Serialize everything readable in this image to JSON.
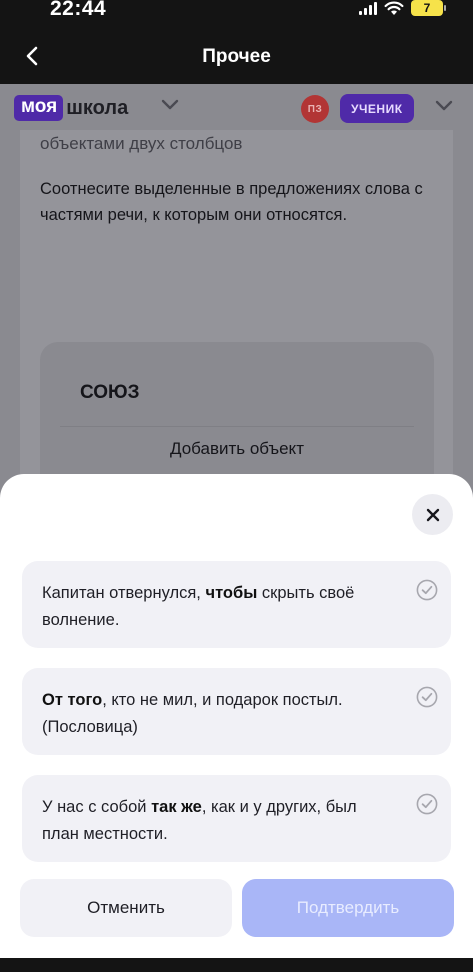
{
  "status": {
    "time": "22:44",
    "battery": "7"
  },
  "nav": {
    "title": "Прочее"
  },
  "header": {
    "logo_badge": "моя",
    "logo_text": "школа",
    "avatar_initials": "ПЗ",
    "role": "УЧЕНИК"
  },
  "task": {
    "cut_text": "объектами двух столбцов",
    "instruction": "Соотнесите выделенные в предложениях слова с частями речи, к которым они относятся.",
    "target_title": "СОЮЗ",
    "add_object_label": "Добавить объект"
  },
  "sheet": {
    "options": [
      {
        "before": "Капитан отвернулся, ",
        "bold": "чтобы",
        "after": " скрыть своё волнение."
      },
      {
        "before": "",
        "bold": "От того",
        "after": ", кто не мил, и подарок постыл. (Пословица)"
      },
      {
        "before": "У нас с собой ",
        "bold": "так же",
        "after": ", как и у других, был план местности."
      }
    ],
    "cancel_label": "Отменить",
    "confirm_label": "Подтвердить"
  },
  "colors": {
    "brand": "#4f2aa8",
    "confirm_disabled": "#a9b6f7",
    "avatar": "#b23535"
  }
}
